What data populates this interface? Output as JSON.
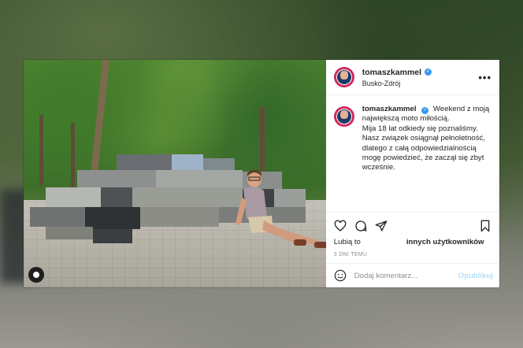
{
  "post": {
    "username": "tomaszkammel",
    "location": "Busko-Zdrój",
    "more_label": "•••",
    "caption_lines": [
      "Weekend z moją",
      "największą moto miłością.",
      "Mija 18 lat odkiedy się poznaliśmy.",
      "Nasz związek osiągnął pełnoletność,",
      "dlatego z całą odpowiedzialnością",
      "mogę powiedzieć, że zaczął się zbyt",
      "wcześnie."
    ],
    "likes_prefix": "Lubią to",
    "likes_suffix": "innych użytkowników",
    "timestamp": "3 DNI TEMU",
    "comment_placeholder": "Dodaj komentarz...",
    "publish_label": "Opublikuj"
  },
  "colors": {
    "verified": "#3897f0",
    "publish_disabled": "#b2dffc",
    "text": "#262626",
    "muted": "#8e8e8e"
  },
  "icons": [
    "user-tag-icon",
    "verified-icon",
    "more-options-icon",
    "heart-icon",
    "comment-icon",
    "share-icon",
    "bookmark-icon",
    "emoji-icon"
  ]
}
